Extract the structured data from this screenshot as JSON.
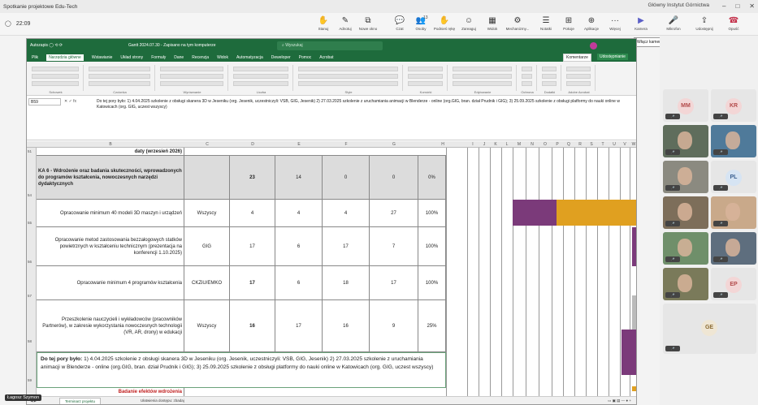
{
  "teams": {
    "window_title": "Spotkanie projektowe Edu-Tech",
    "org": "Główny Instytut Górnictwa",
    "timer": "22:09",
    "toolbar": [
      {
        "label": "Stanuj",
        "icon": "hand-icon"
      },
      {
        "label": "Adnotuj",
        "icon": "pen-icon"
      },
      {
        "label": "Nowe okno",
        "icon": "new-window-icon"
      },
      {
        "label": "Czat",
        "icon": "chat-icon"
      },
      {
        "label": "Osoby",
        "icon": "people-icon",
        "badge": "13"
      },
      {
        "label": "Podnieś rękę",
        "icon": "raise-hand-icon"
      },
      {
        "label": "Zareaguj",
        "icon": "emoji-icon"
      },
      {
        "label": "Widok",
        "icon": "grid-icon"
      },
      {
        "label": "Mechanizmy...",
        "icon": "mechanisms-icon"
      },
      {
        "label": "Notatki",
        "icon": "notes-icon"
      },
      {
        "label": "Pokoje",
        "icon": "rooms-icon"
      },
      {
        "label": "Aplikacje",
        "icon": "apps-icon"
      },
      {
        "label": "Więcej",
        "icon": "more-icon"
      },
      {
        "label": "Kamera",
        "icon": "camera-icon"
      },
      {
        "label": "Mikrofon",
        "icon": "mic-icon"
      },
      {
        "label": "Udostępnij",
        "icon": "share-icon"
      },
      {
        "label": "Opuść",
        "icon": "leave-icon"
      }
    ],
    "tooltip": "Włącz kamerę (Ctrl+Shift+O)",
    "participants": [
      {
        "initials": "MM",
        "bg": "#f3d6d6",
        "fg": "#b34a4a"
      },
      {
        "initials": "KR",
        "bg": "#f3d6d6",
        "fg": "#b34a4a"
      },
      {
        "initials": "",
        "video": true
      },
      {
        "initials": "",
        "video": true
      },
      {
        "initials": "",
        "video": true
      },
      {
        "initials": "PL",
        "bg": "#d6e4f3",
        "fg": "#3a5f8f"
      },
      {
        "initials": "",
        "video": true
      },
      {
        "initials": "",
        "video": true
      },
      {
        "initials": "",
        "video": true
      },
      {
        "initials": "",
        "video": true
      },
      {
        "initials": "",
        "video": true
      },
      {
        "initials": "EP",
        "bg": "#f3d6d6",
        "fg": "#b34a4a"
      },
      {
        "initials": "GE",
        "bg": "#efe6d4",
        "fg": "#8a6a32"
      }
    ],
    "presenter_name": "Łagosz Szymon"
  },
  "excel": {
    "file_title": "Gantt 2024.07.30 - Zapisano na tym komputerze",
    "search_placeholder": "Wyszukaj",
    "menu": [
      "Plik",
      "Narzędzia główne",
      "Wstawianie",
      "Układ strony",
      "Formuły",
      "Dane",
      "Recenzja",
      "Widok",
      "Automatyzacja",
      "Deweloper",
      "Pomoc",
      "Acrobat"
    ],
    "comment_btn": "Komentarze",
    "share_btn": "Udostępnianie",
    "ribbon_groups": [
      "Schowek",
      "Czcionka",
      "Wyrównanie",
      "Liczba",
      "Style",
      "Komórki",
      "Edytowanie",
      "Ochrona",
      "Dodatki",
      "Adobe Acrobat"
    ],
    "name_box": "B59",
    "formula_text": "Do tej pory było: 1) 4.04.2025 szkolenie z obsługi skanera 3D w Jeseniku (org. Jesenik, uczestniczyli: VSB, GIG, Jesenik) 2) 27.03.2025 szkolenie z uruchamiania animacji w Blenderze - online (org.GIG, bran. dział Prudnik i GIG); 3) 25.09.2025 szkolenie z obsługi platformy do nauki online w Katowicach (org. GIG, uczest wszyscy)",
    "col_headers": [
      "B",
      "C",
      "D",
      "E",
      "F",
      "G",
      "H",
      "I",
      "J",
      "K",
      "L",
      "M",
      "N",
      "O",
      "P",
      "Q",
      "R",
      "S",
      "T",
      "U",
      "V",
      "W",
      "X",
      "Y"
    ],
    "row_numbers": [
      "51",
      "54",
      "55",
      "56",
      "57",
      "58",
      "59"
    ],
    "top_partial": "daty (wrzesień 2026)",
    "rows": [
      {
        "label": "KA 6 - Wdrożenie oraz badania skuteczności, wprowadzonych do programów kształcenia, nowoczesnych narzędzi dydaktycznych",
        "who": "",
        "d": "23",
        "e": "14",
        "f": "0",
        "g": "0",
        "h": "0%",
        "bold": true
      },
      {
        "label": "Opracowanie minimum 40 modeli 3D maszyn i urządzeń",
        "who": "Wszyscy",
        "d": "4",
        "e": "4",
        "f": "4",
        "g": "27",
        "h": "100%",
        "bold": false
      },
      {
        "label": "Opracowanie metod zastosowania bezzałogowych statków powietrznych w kształceniu technicznym (prezentacja na konferencji 1.10.2025)",
        "who": "GIG",
        "d": "17",
        "e": "6",
        "f": "17",
        "g": "7",
        "h": "100%",
        "bold": false
      },
      {
        "label": "Opracowanie minimum 4 programów kształcenia",
        "who": "CKZiU/EMKO",
        "d": "17",
        "e": "6",
        "f": "18",
        "g": "17",
        "h": "100%",
        "bold": false
      },
      {
        "label": "Przeszkolenie nauczycieli i wykładowców (pracowników Partnerów), w zakresie wykorzystania nowoczesnych technologii (VR, AR, drony) w edukacji",
        "who": "Wszyscy",
        "d": "16",
        "e": "17",
        "f": "16",
        "g": "9",
        "h": "25%",
        "bold": false
      }
    ],
    "note_text": "Do tej pory było: 1) 4.04.2025 szkolenie z obsługi skanera 3D w Jeseniku (org. Jesenik, uczestniczyli: VSB, GIG, Jesenik) 2) 27.03.2025 szkolenie z uruchamiania animacji w Blenderze - online (org.GIG, bran. dział Prudnik i GIG); 3) 25.09.2025 szkolenie z obsługi platformy do nauki online w Katowicach (org. GIG, uczest wszyscy)",
    "note_bold": "Do tej pory było:",
    "bottom_partial": "Badanie efektów wdrożenia",
    "sheet_tab": "Terminarz projektu",
    "status_text": "Ułatwienia dostępu: zbadaj",
    "colors": {
      "green": "#1e6b3c",
      "purple": "#7b3a7a",
      "gold": "#e0a020"
    }
  }
}
